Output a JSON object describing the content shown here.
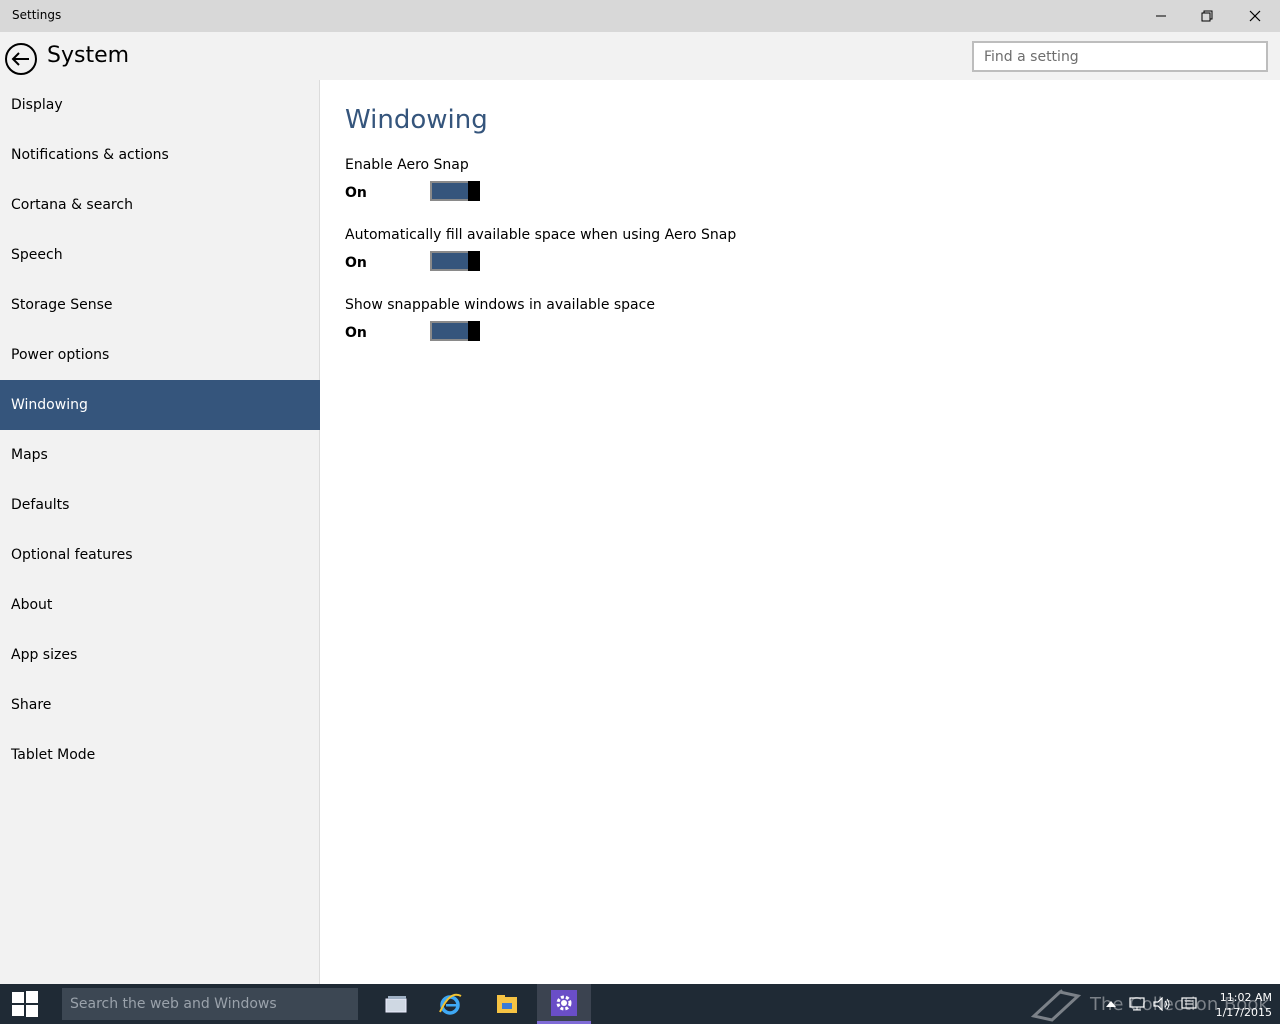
{
  "window": {
    "title": "Settings"
  },
  "header": {
    "section_title": "System",
    "search_placeholder": "Find a setting"
  },
  "sidebar": {
    "items": [
      {
        "label": "Display"
      },
      {
        "label": "Notifications & actions"
      },
      {
        "label": "Cortana & search"
      },
      {
        "label": "Speech"
      },
      {
        "label": "Storage Sense"
      },
      {
        "label": "Power options"
      },
      {
        "label": "Windowing"
      },
      {
        "label": "Maps"
      },
      {
        "label": "Defaults"
      },
      {
        "label": "Optional features"
      },
      {
        "label": "About"
      },
      {
        "label": "App sizes"
      },
      {
        "label": "Share"
      },
      {
        "label": "Tablet Mode"
      }
    ],
    "selected": "Windowing"
  },
  "main": {
    "heading": "Windowing",
    "settings": [
      {
        "label": "Enable Aero Snap",
        "state": "On",
        "enabled": true
      },
      {
        "label": "Automatically fill available space when using Aero Snap",
        "state": "On",
        "enabled": true
      },
      {
        "label": "Show snappable windows in available space",
        "state": "On",
        "enabled": true
      }
    ]
  },
  "taskbar": {
    "search_placeholder": "Search the web and Windows",
    "watermark": "The Collection Book",
    "time": "11:02 AM",
    "date": "1/17/2015"
  },
  "colors": {
    "accent": "#35557c",
    "taskbar": "#1f2a35",
    "title_bar": "#d8d8d8",
    "sidebar_bg": "#f2f2f2"
  }
}
